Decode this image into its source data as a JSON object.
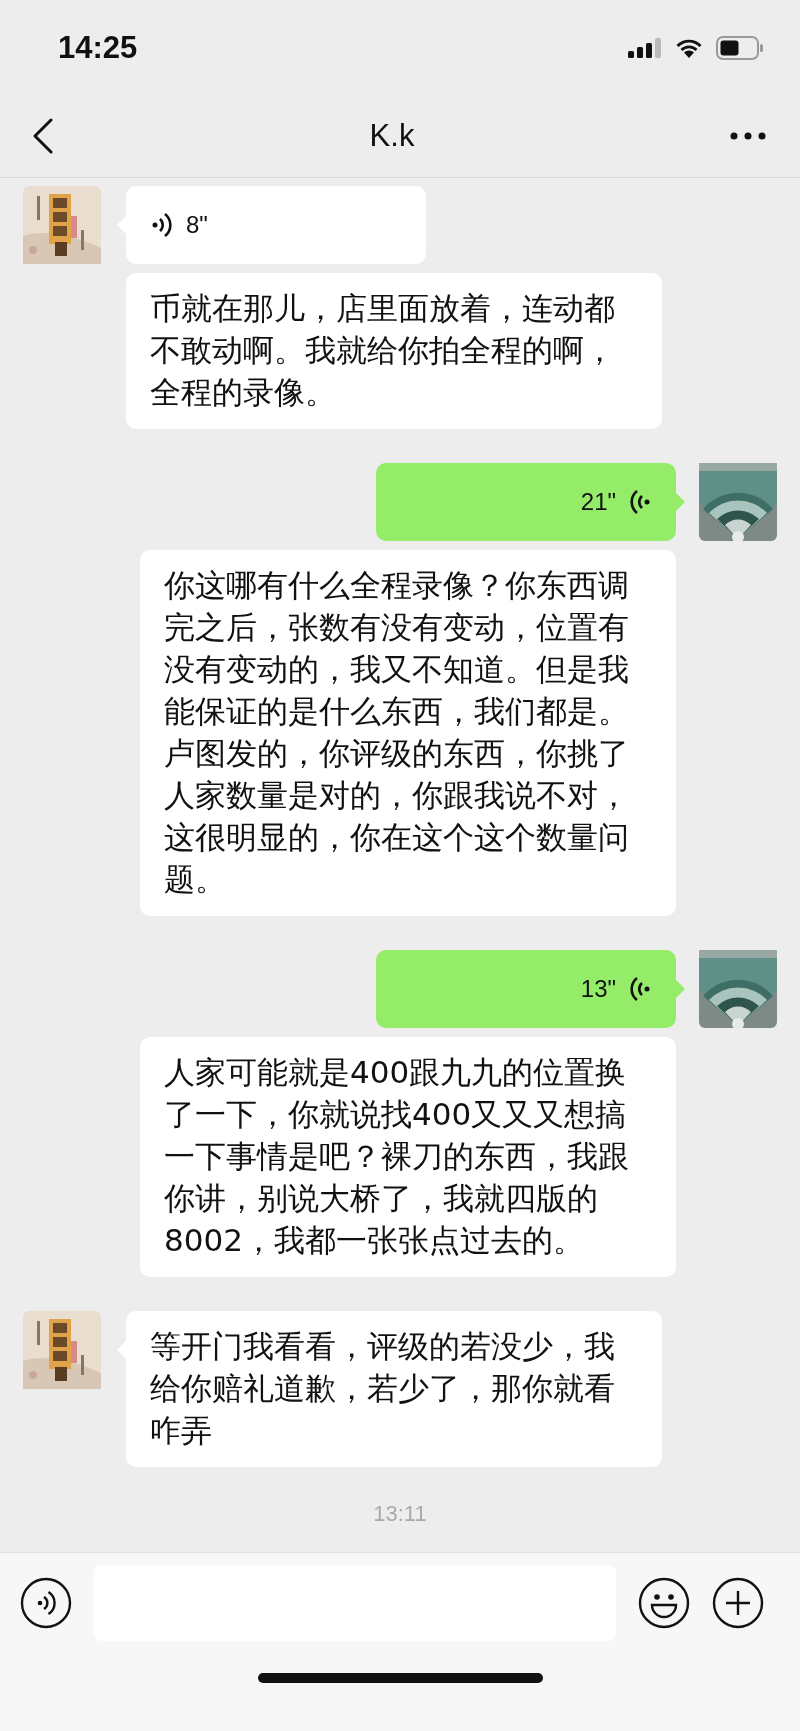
{
  "status_bar": {
    "time": "14:25"
  },
  "nav": {
    "title": "K.k"
  },
  "messages": [
    {
      "outgoing": false,
      "kind": "voice",
      "duration": "8\"",
      "transcript": "币就在那儿，店里面放着，连动都不敢动啊。我就给你拍全程的啊，全程的录像。"
    },
    {
      "outgoing": true,
      "kind": "voice",
      "duration": "21\"",
      "transcript": "你这哪有什么全程录像？你东西调完之后，张数有没有变动，位置有没有变动的，我又不知道。但是我能保证的是什么东西，我们都是。卢图发的，你评级的东西，你挑了人家数量是对的，你跟我说不对，这很明显的，你在这个这个数量问题。"
    },
    {
      "outgoing": true,
      "kind": "voice",
      "duration": "13\"",
      "transcript": "人家可能就是400跟九九的位置换了一下，你就说找400又又又想搞一下事情是吧？裸刀的东西，我跟你讲，别说大桥了，我就四版的8002，我都一张张点过去的。"
    },
    {
      "outgoing": false,
      "kind": "text",
      "text": "等开门我看看，评级的若没少，我给你赔礼道歉，若少了，那你就看咋弄"
    }
  ],
  "timestamp": "13:11"
}
